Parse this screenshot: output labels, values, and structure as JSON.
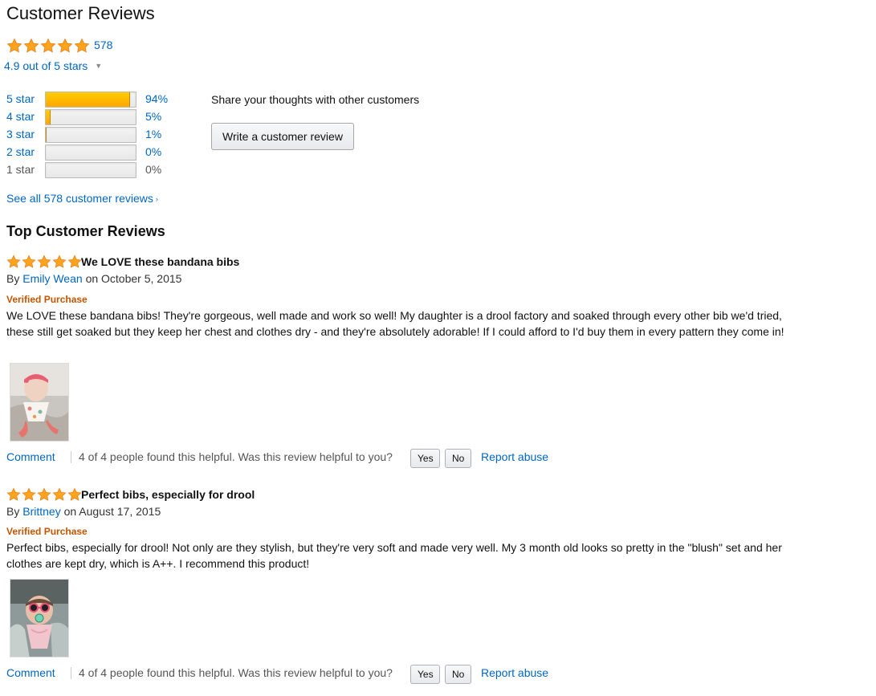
{
  "header": {
    "title": "Customer Reviews",
    "review_count": "578",
    "average_text": "4.9 out of 5 stars",
    "rating": 4.9
  },
  "histogram": [
    {
      "label": "5 star",
      "percent_text": "94%",
      "fraction": 0.94
    },
    {
      "label": "4 star",
      "percent_text": "5%",
      "fraction": 0.05
    },
    {
      "label": "3 star",
      "percent_text": "1%",
      "fraction": 0.01
    },
    {
      "label": "2 star",
      "percent_text": "0%",
      "fraction": 0.0
    },
    {
      "label": "1 star",
      "percent_text": "0%",
      "fraction": 0.0
    }
  ],
  "share": {
    "prompt": "Share your thoughts with other customers",
    "button_label": "Write a customer review"
  },
  "see_all_link": "See all 578 customer reviews",
  "top_reviews_title": "Top Customer Reviews",
  "reviews": [
    {
      "rating": 5,
      "title": "We LOVE these bandana bibs",
      "by_prefix": "By",
      "author": "Emily Wean",
      "date": "on October 5, 2015",
      "verified": "Verified Purchase",
      "body": "We LOVE these bandana bibs! They're gorgeous, well made and work so well! My daughter is a drool factory and soaked through every other bib we'd tried, these still get soaked but they keep her chest and clothes dry - and they're absolutely adorable! If I could afford to I'd buy them in every pattern they come in!",
      "comment_label": "Comment",
      "helpful_text": "4 of 4 people found this helpful. Was this review helpful to you?",
      "yes_label": "Yes",
      "no_label": "No",
      "report_label": "Report abuse"
    },
    {
      "rating": 5,
      "title": "Perfect bibs, especially for drool",
      "by_prefix": "By",
      "author": "Brittney",
      "date": "on August 17, 2015",
      "verified": "Verified Purchase",
      "body": "Perfect bibs, especially for drool! Not only are they stylish, but they're very soft and made very well. My 3 month old looks so pretty in the \"blush\" set and her clothes are kept dry, which is A++. I recommend this product!",
      "comment_label": "Comment",
      "helpful_text": "4 of 4 people found this helpful. Was this review helpful to you?",
      "yes_label": "Yes",
      "no_label": "No",
      "report_label": "Report abuse"
    }
  ],
  "colors": {
    "link": "#0066c0",
    "star": "#ffa41c",
    "verified": "#c45500",
    "bar_fill": "#ffa700"
  },
  "icons": {
    "star": "star-icon",
    "caret": "caret-down-icon",
    "arrow": "arrow-right-icon"
  }
}
